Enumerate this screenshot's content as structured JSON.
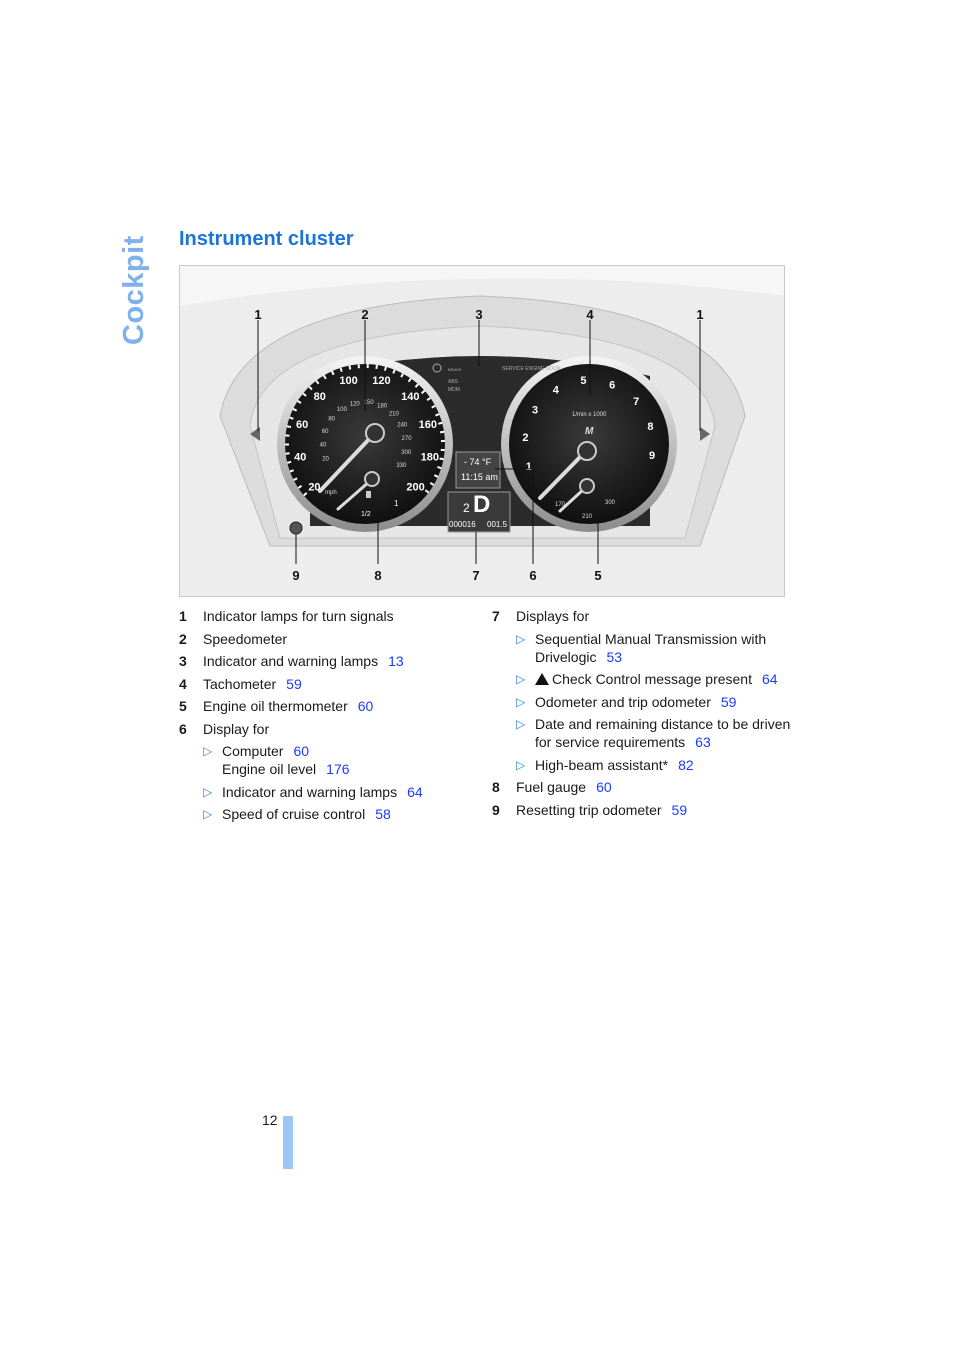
{
  "side_tab": "Cockpit",
  "section_title": "Instrument cluster",
  "figure": {
    "callouts_top": [
      "1",
      "2",
      "3",
      "4",
      "1"
    ],
    "callouts_bottom": [
      "9",
      "8",
      "7",
      "6",
      "5"
    ],
    "speedometer_labels": [
      "20",
      "40",
      "60",
      "80",
      "100",
      "120",
      "140",
      "160",
      "180",
      "200"
    ],
    "speedometer_inner_labels": [
      "20",
      "40",
      "60",
      "80",
      "100",
      "120",
      "150",
      "180",
      "210",
      "240",
      "270",
      "300",
      "330"
    ],
    "speedometer_unit": "mph",
    "tachometer_labels": [
      "1",
      "2",
      "3",
      "4",
      "5",
      "6",
      "7",
      "8",
      "9"
    ],
    "tachometer_unit": "1/min x 1000",
    "tach_brand": "M",
    "display": {
      "temperature": "- 74 °F",
      "time": "11:15 am",
      "gear_small": "2",
      "gear": "D",
      "odometer": "000016",
      "trip": "001.5"
    },
    "fuel_labels": [
      "1/2",
      "1"
    ],
    "oil_labels": [
      "170",
      "210",
      "300"
    ],
    "warning_lamps": [
      "BRAKE",
      "ABS",
      "MDM",
      "SERVICE ENGINE SOON"
    ]
  },
  "legend_left": [
    {
      "num": "1",
      "text": "Indicator lamps for turn signals",
      "ref": ""
    },
    {
      "num": "2",
      "text": "Speedometer",
      "ref": ""
    },
    {
      "num": "3",
      "text": "Indicator and warning lamps",
      "ref": "13"
    },
    {
      "num": "4",
      "text": "Tachometer",
      "ref": "59"
    },
    {
      "num": "5",
      "text": "Engine oil thermometer",
      "ref": "60"
    },
    {
      "num": "6",
      "text": "Display for",
      "ref": ""
    }
  ],
  "legend_6_subs": [
    {
      "text": "Computer",
      "ref": "60",
      "line2": "Engine oil level",
      "ref2": "176"
    },
    {
      "text": "Indicator and warning lamps",
      "ref": "64"
    },
    {
      "text": "Speed of cruise control",
      "ref": "58"
    }
  ],
  "legend_7": {
    "num": "7",
    "text": "Displays for"
  },
  "legend_7_subs": [
    {
      "text": "Sequential Manual Transmission with Drivelogic",
      "ref": "53"
    },
    {
      "text": "Check Control message present",
      "ref": "64",
      "icon": "warning-triangle-icon"
    },
    {
      "text": "Odometer and trip odometer",
      "ref": "59"
    },
    {
      "text": "Date and remaining distance to be driven for service requirements",
      "ref": "63"
    },
    {
      "text": "High-beam assistant*",
      "ref": "82"
    }
  ],
  "legend_right": [
    {
      "num": "8",
      "text": "Fuel gauge",
      "ref": "60"
    },
    {
      "num": "9",
      "text": "Resetting trip odometer",
      "ref": "59"
    }
  ],
  "page_number": "12",
  "colors": {
    "accent": "#1d74d8",
    "side_tab": "#7fb2ea",
    "link": "#1a3cff",
    "page_bar": "#9ec6f4"
  }
}
